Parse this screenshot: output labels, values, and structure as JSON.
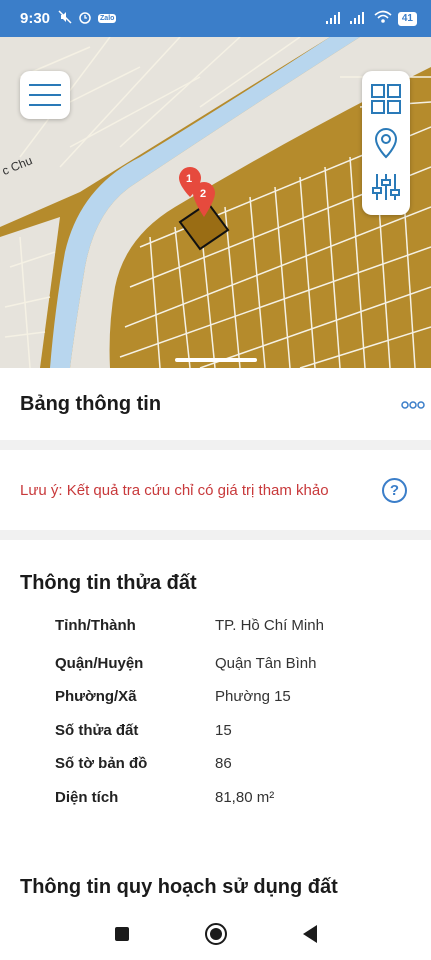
{
  "status_bar": {
    "time": "9:30",
    "battery": "41",
    "zalo_label": "Zalo"
  },
  "map": {
    "street_label": "c Chu",
    "pins": [
      "1",
      "2"
    ],
    "tool_icons": [
      "grid-icon",
      "location-pin-icon",
      "sliders-icon"
    ],
    "colors": {
      "parcel": "#b58b2c",
      "river": "#b8d6ee",
      "road": "#e6e3dc",
      "selected": "#9a6d14"
    }
  },
  "sheet": {
    "title": "Bảng thông tin",
    "more": "ooo",
    "note": "Lưu ý: Kết quả tra cứu chỉ có giá trị tham khảo",
    "help": "?",
    "parcel": {
      "title": "Thông tin thửa đất",
      "rows": [
        {
          "label": "Tỉnh/Thành",
          "value": "TP. Hồ Chí Minh"
        },
        {
          "label": "Quận/Huyện",
          "value": "Quận Tân Bình"
        },
        {
          "label": "Phường/Xã",
          "value": "Phường 15"
        },
        {
          "label": "Số thửa đất",
          "value": "15"
        },
        {
          "label": "Số tờ bản đồ",
          "value": "86"
        },
        {
          "label": "Diện tích",
          "value": "81,80 m²"
        }
      ]
    },
    "planning_title": "Thông tin quy hoạch sử dụng đất"
  },
  "nav": [
    "recent-apps-icon",
    "home-icon",
    "back-icon"
  ]
}
